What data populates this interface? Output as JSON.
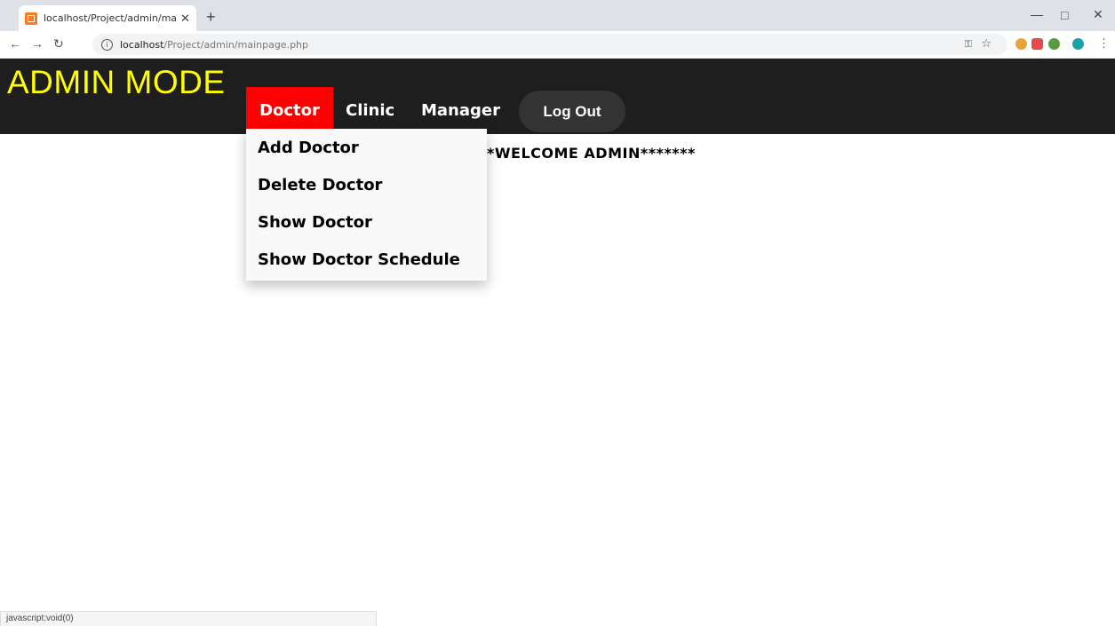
{
  "browser": {
    "tab_title": "localhost/Project/admin/mainpa ",
    "tab_close": "✕",
    "new_tab": "+",
    "url_host": "localhost",
    "url_path": "/Project/admin/mainpage.php",
    "status_text": "javascript:void(0)"
  },
  "header": {
    "brand": "ADMIN MODE",
    "nav": [
      "Doctor",
      "Clinic",
      "Manager"
    ],
    "logout": "Log Out"
  },
  "main": {
    "welcome": "*WELCOME ADMIN*******"
  },
  "dropdown": {
    "items": [
      "Add Doctor",
      "Delete Doctor",
      "Show Doctor",
      "Show Doctor Schedule"
    ]
  },
  "colors": {
    "header_bg": "#1e1e1e",
    "brand": "#ffff00",
    "active_nav": "#ff0000"
  },
  "icons": [
    "back-icon",
    "forward-icon",
    "reload-icon",
    "info-icon",
    "key-icon",
    "star-icon",
    "minimize-icon",
    "maximize-icon",
    "close-window-icon"
  ]
}
